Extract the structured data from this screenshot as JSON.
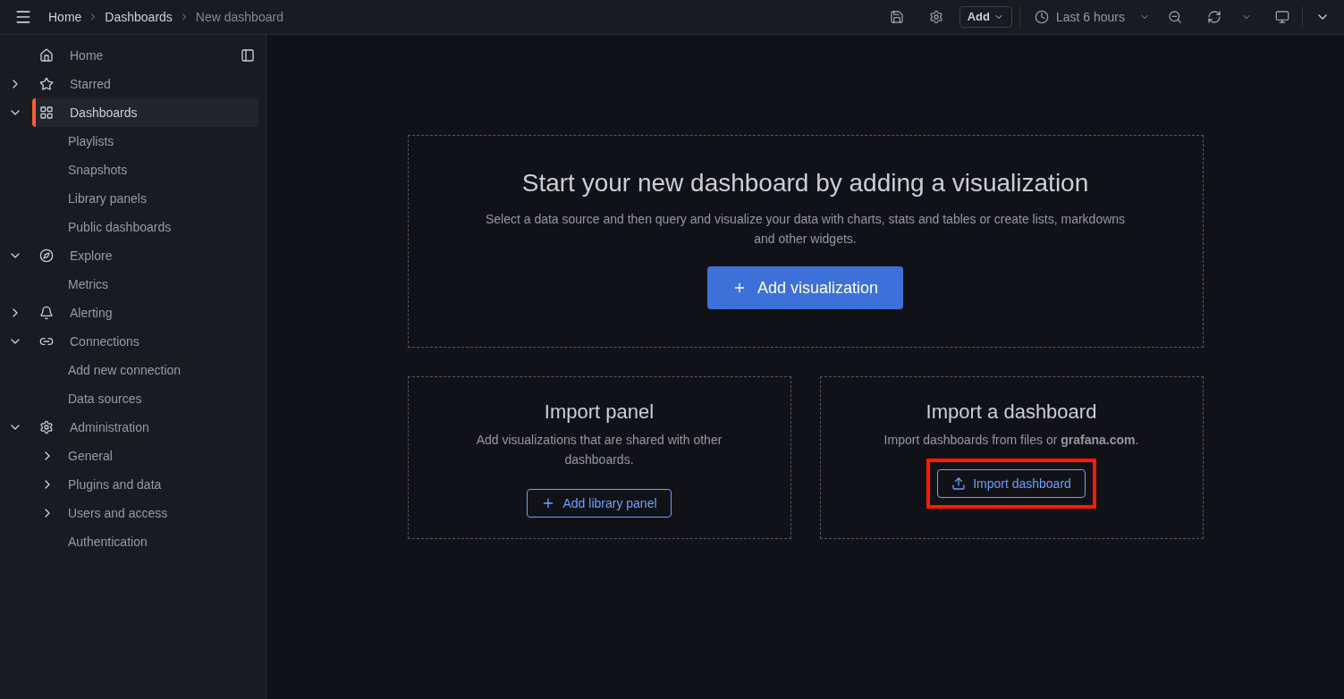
{
  "breadcrumbs": [
    {
      "label": "Home",
      "current": false
    },
    {
      "label": "Dashboards",
      "current": false
    },
    {
      "label": "New dashboard",
      "current": true
    }
  ],
  "toolbar": {
    "add_button": "Add",
    "time_range": "Last 6 hours"
  },
  "sidebar": {
    "items": [
      {
        "label": "Home",
        "selected": false
      },
      {
        "label": "Starred",
        "selected": false,
        "expanded": false
      },
      {
        "label": "Dashboards",
        "selected": true,
        "expanded": true,
        "children": [
          {
            "label": "Playlists",
            "selected": false
          },
          {
            "label": "Snapshots",
            "selected": false
          },
          {
            "label": "Library panels",
            "selected": false
          },
          {
            "label": "Public dashboards",
            "selected": false
          }
        ]
      },
      {
        "label": "Explore",
        "selected": false,
        "expanded": true,
        "children": [
          {
            "label": "Metrics",
            "selected": false
          }
        ]
      },
      {
        "label": "Alerting",
        "selected": false,
        "expanded": false
      },
      {
        "label": "Connections",
        "selected": false,
        "expanded": true,
        "children": [
          {
            "label": "Add new connection",
            "selected": false
          },
          {
            "label": "Data sources",
            "selected": false
          }
        ]
      },
      {
        "label": "Administration",
        "selected": false,
        "expanded": true,
        "children": [
          {
            "label": "General",
            "selected": false,
            "expanded": false
          },
          {
            "label": "Plugins and data",
            "selected": false,
            "expanded": false
          },
          {
            "label": "Users and access",
            "selected": false,
            "expanded": false
          },
          {
            "label": "Authentication",
            "selected": false
          }
        ]
      }
    ]
  },
  "hero": {
    "title": "Start your new dashboard by adding a visualization",
    "description": "Select a data source and then query and visualize your data with charts, stats and tables or create lists, markdowns and other widgets.",
    "button": "Add visualization"
  },
  "cards": [
    {
      "title": "Import panel",
      "description": "Add visualizations that are shared with other dashboards.",
      "button": "Add library panel",
      "kind": "library",
      "highlighted": false
    },
    {
      "title": "Import a dashboard",
      "description": "Import dashboards from files or **grafana.com**.",
      "button": "Import dashboard",
      "kind": "import",
      "highlighted": true
    }
  ]
}
